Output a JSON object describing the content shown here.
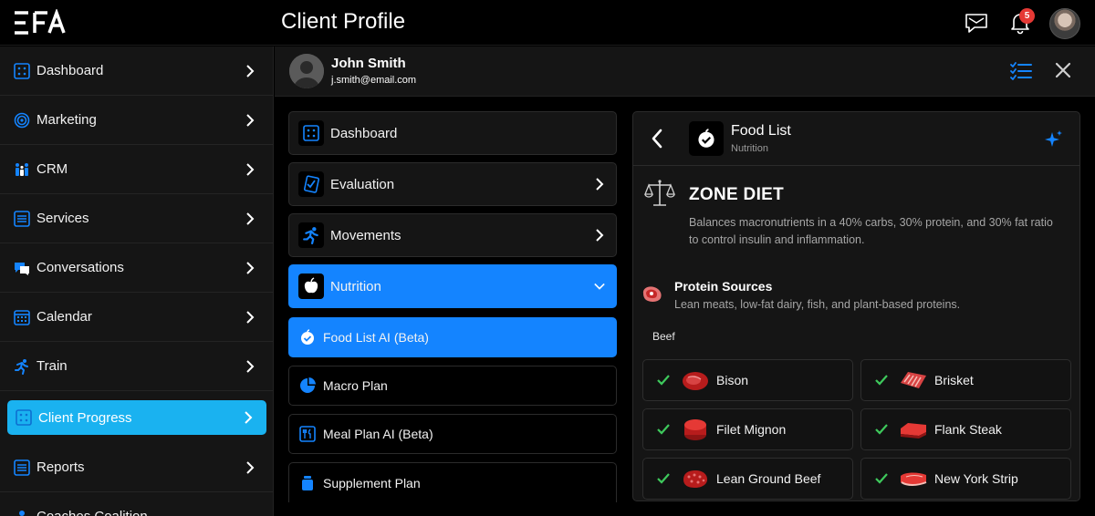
{
  "app": {
    "logo_text": "EFA",
    "page_title": "Client Profile",
    "notification_count": "5"
  },
  "sidebar": {
    "items": [
      {
        "label": "Dashboard",
        "icon": "dashboard-icon"
      },
      {
        "label": "Marketing",
        "icon": "target-icon"
      },
      {
        "label": "CRM",
        "icon": "people-icon"
      },
      {
        "label": "Services",
        "icon": "list-icon"
      },
      {
        "label": "Conversations",
        "icon": "chat-icon"
      },
      {
        "label": "Calendar",
        "icon": "calendar-icon"
      },
      {
        "label": "Train",
        "icon": "runner-icon"
      },
      {
        "label": "Client Progress",
        "icon": "progress-icon",
        "active": true
      },
      {
        "label": "Reports",
        "icon": "report-icon"
      },
      {
        "label": "Coaches Coalition",
        "icon": "coalition-icon"
      }
    ]
  },
  "client": {
    "name": "John Smith",
    "email": "j.smith@email.com"
  },
  "profile_menu": {
    "items": [
      {
        "label": "Dashboard",
        "icon": "dashboard-icon"
      },
      {
        "label": "Evaluation",
        "icon": "clipboard-check-icon"
      },
      {
        "label": "Movements",
        "icon": "runner-icon"
      },
      {
        "label": "Nutrition",
        "icon": "apple-icon",
        "expanded": true
      }
    ],
    "sub_items": [
      {
        "label": "Food List AI (Beta)",
        "icon": "apple-check-icon",
        "active": true
      },
      {
        "label": "Macro Plan",
        "icon": "pie-chart-icon"
      },
      {
        "label": "Meal Plan AI (Beta)",
        "icon": "meal-plan-icon"
      },
      {
        "label": "Supplement Plan",
        "icon": "supplement-jar-icon"
      }
    ]
  },
  "food_list": {
    "title": "Food List",
    "subtitle": "Nutrition",
    "diet_title": "ZONE DIET",
    "diet_description": "Balances macronutrients in a 40% carbs, 30% protein, and 30% fat ratio to control insulin and inflammation.",
    "section_title": "Protein Sources",
    "section_description": "Lean meats, low-fat dairy, fish, and plant-based proteins.",
    "category": "Beef",
    "foods": [
      {
        "label": "Bison",
        "checked": true
      },
      {
        "label": "Brisket",
        "checked": true
      },
      {
        "label": "Filet Mignon",
        "checked": true
      },
      {
        "label": "Flank Steak",
        "checked": true
      },
      {
        "label": "Lean Ground Beef",
        "checked": true
      },
      {
        "label": "New York Strip",
        "checked": true
      }
    ]
  },
  "colors": {
    "accent_blue": "#1484ff",
    "sidebar_active": "#1ab2f0",
    "check_green": "#3ec95c",
    "badge_red": "#e53935",
    "meat_red": "#c62828"
  }
}
